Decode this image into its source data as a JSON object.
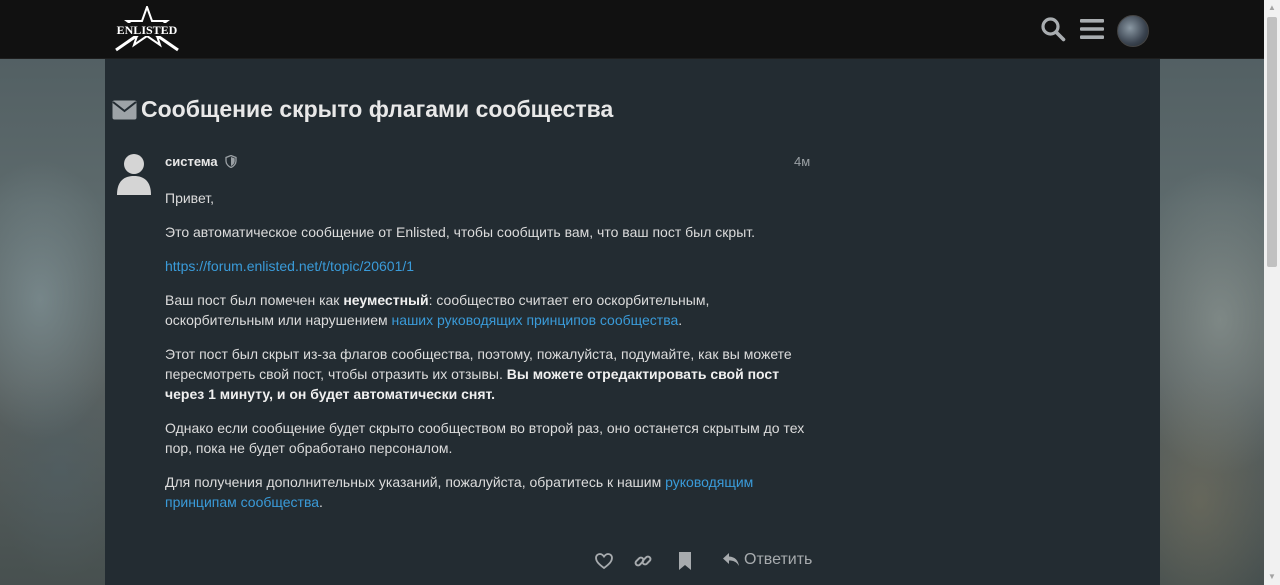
{
  "header": {
    "logo_text": "ENLISTED",
    "search_icon": "search-icon",
    "menu_icon": "hamburger-menu-icon",
    "avatar_icon": "user-avatar"
  },
  "topic": {
    "title": "Сообщение скрыто флагами сообщества",
    "title_icon": "envelope-icon"
  },
  "post": {
    "username": "система",
    "date": "4м",
    "paragraphs": {
      "greeting": "Привет,",
      "intro": "Это автоматическое сообщение от Enlisted, чтобы сообщить вам, что ваш пост был скрыт.",
      "link": "https://forum.enlisted.net/t/topic/20601/1",
      "p4_before": "Ваш пост был помечен как ",
      "p4_bold": "неуместный",
      "p4_middle": ": сообщество считает его оскорбительным, оскорбительным или нарушением ",
      "p4_link": "наших руководящих принципов сообщества",
      "p4_after": ".",
      "p5_text": "Этот пост был скрыт из-за флагов сообщества, поэтому, пожалуйста, подумайте, как вы можете пересмотреть свой пост, чтобы отразить их отзывы. ",
      "p5_bold": "Вы можете отредактировать свой пост через 1 минуту, и он будет автоматически снят.",
      "p6": "Однако если сообщение будет скрыто сообществом во второй раз, оно останется скрытым до тех пор, пока не будет обработано персоналом.",
      "p7_before": "Для получения дополнительных указаний, пожалуйста, обратитесь к нашим ",
      "p7_link": "руководящим принципам сообщества",
      "p7_after": "."
    },
    "actions": {
      "like_icon": "heart-icon",
      "link_icon": "link-icon",
      "bookmark_icon": "bookmark-icon",
      "reply_label": "Ответить"
    }
  },
  "colors": {
    "header_bg": "#111111",
    "panel_bg": "#232c32",
    "link": "#3a9bd9",
    "text": "#dcdcdc"
  }
}
